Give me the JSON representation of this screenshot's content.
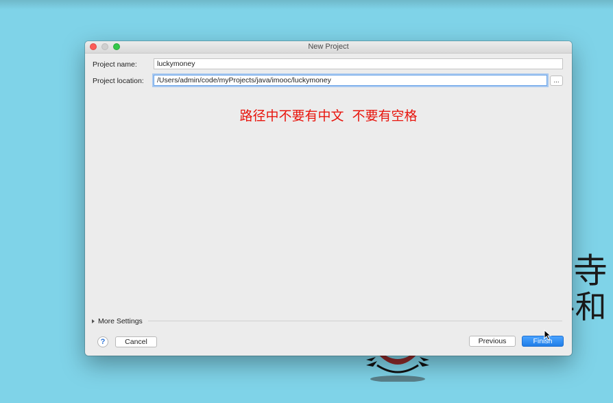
{
  "window": {
    "title": "New Project"
  },
  "form": {
    "project_name_label": "Project name:",
    "project_name_value": "luckymoney",
    "project_location_label": "Project location:",
    "project_location_value": "/Users/admin/code/myProjects/java/imooc/luckymoney",
    "browse_label": "..."
  },
  "annotation": {
    "text": "路径中不要有中文  不要有空格"
  },
  "more_settings": {
    "label": "More Settings"
  },
  "buttons": {
    "help_label": "?",
    "cancel_label": "Cancel",
    "previous_label": "Previous",
    "finish_label": "Finish"
  },
  "background": {
    "glyph_1": "寺",
    "glyph_2": "-和"
  },
  "colors": {
    "desktop": "#7fd3e8",
    "window": "#ececec",
    "annotation": "#e8140c",
    "accent": "#1f7de8",
    "close": "#fc5b57",
    "maximize": "#34c84a"
  },
  "icons": {
    "close": "close-icon",
    "minimize": "minimize-icon",
    "maximize": "maximize-icon",
    "disclosure": "disclosure-triangle-icon",
    "cursor": "mouse-cursor-icon"
  }
}
